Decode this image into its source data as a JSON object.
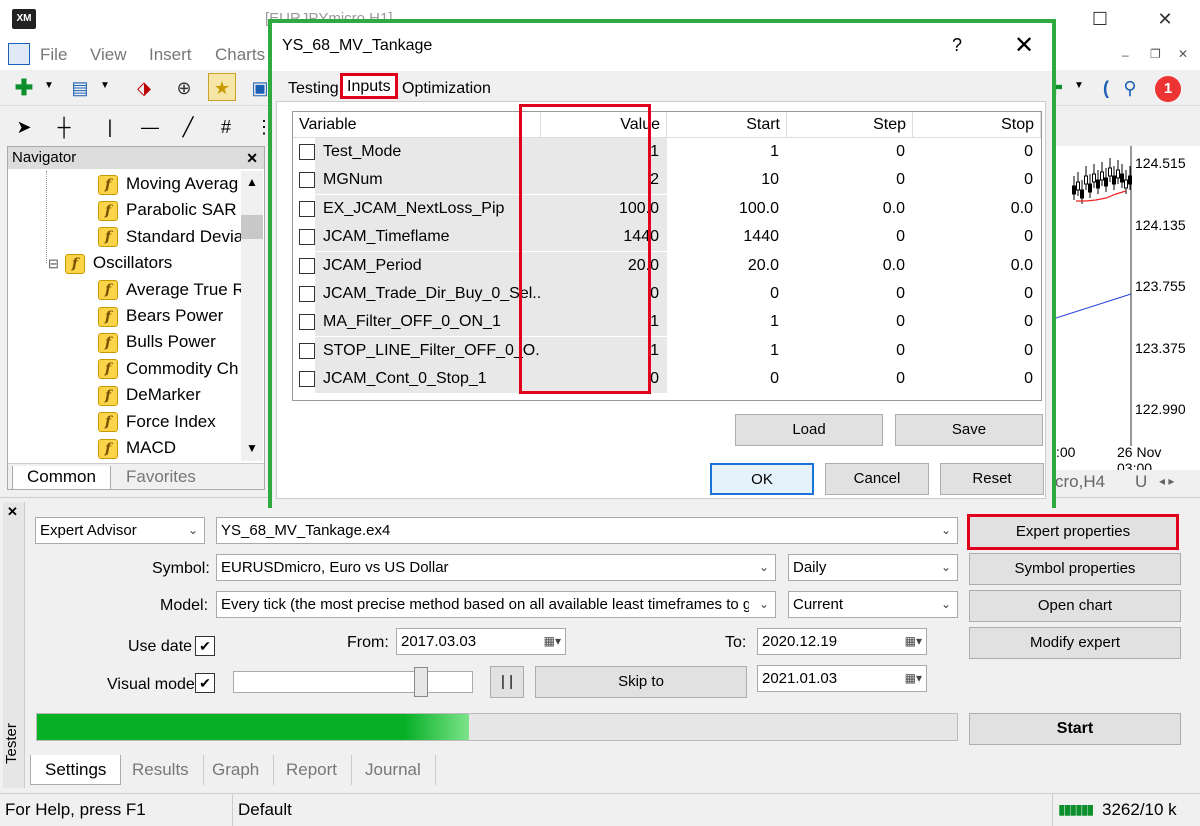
{
  "window": {
    "title": "[EURJPYmicro,H1]",
    "logo": "XM",
    "minimize": "—",
    "maximize": "☐",
    "close": "✕"
  },
  "menu": [
    "File",
    "View",
    "Insert",
    "Charts"
  ],
  "mdi_controls": {
    "minimize": "–",
    "restore": "❐",
    "close": "✕"
  },
  "notification_count": "1",
  "navigator": {
    "title": "Navigator",
    "close": "✕",
    "items": [
      {
        "label": "Moving Averag",
        "indent": 2
      },
      {
        "label": "Parabolic SAR",
        "indent": 2
      },
      {
        "label": "Standard Devia",
        "indent": 2
      },
      {
        "label": "Oscillators",
        "indent": 1
      },
      {
        "label": "Average True R",
        "indent": 2
      },
      {
        "label": "Bears Power",
        "indent": 2
      },
      {
        "label": "Bulls Power",
        "indent": 2
      },
      {
        "label": "Commodity Ch",
        "indent": 2
      },
      {
        "label": "DeMarker",
        "indent": 2
      },
      {
        "label": "Force Index",
        "indent": 2
      },
      {
        "label": "MACD",
        "indent": 2
      }
    ],
    "tabs": [
      "Common",
      "Favorites"
    ]
  },
  "chart": {
    "prices": [
      "124.515",
      "124.135",
      "123.755",
      "123.375",
      "122.990"
    ],
    "time_labels": [
      ":00",
      "26 Nov 03:00"
    ],
    "tabs": [
      "cro,H4",
      "U"
    ]
  },
  "dialog": {
    "title": "YS_68_MV_Tankage",
    "help": "?",
    "close": "✕",
    "tabs": [
      "Testing",
      "Inputs",
      "Optimization"
    ],
    "columns": [
      "Variable",
      "Value",
      "Start",
      "Step",
      "Stop"
    ],
    "rows": [
      {
        "variable": "Test_Mode",
        "value": "1",
        "start": "1",
        "step": "0",
        "stop": "0"
      },
      {
        "variable": "MGNum",
        "value": "2",
        "start": "10",
        "step": "0",
        "stop": "0"
      },
      {
        "variable": "EX_JCAM_NextLoss_Pip",
        "value": "100.0",
        "start": "100.0",
        "step": "0.0",
        "stop": "0.0"
      },
      {
        "variable": "JCAM_Timeflame",
        "value": "1440",
        "start": "1440",
        "step": "0",
        "stop": "0"
      },
      {
        "variable": "JCAM_Period",
        "value": "20.0",
        "start": "20.0",
        "step": "0.0",
        "stop": "0.0"
      },
      {
        "variable": "JCAM_Trade_Dir_Buy_0_Sel...",
        "value": "0",
        "start": "0",
        "step": "0",
        "stop": "0"
      },
      {
        "variable": "MA_Filter_OFF_0_ON_1",
        "value": "1",
        "start": "1",
        "step": "0",
        "stop": "0"
      },
      {
        "variable": "STOP_LINE_Filter_OFF_0_O...",
        "value": "1",
        "start": "1",
        "step": "0",
        "stop": "0"
      },
      {
        "variable": "JCAM_Cont_0_Stop_1",
        "value": "0",
        "start": "0",
        "step": "0",
        "stop": "0"
      }
    ],
    "load": "Load",
    "save": "Save",
    "ok": "OK",
    "cancel": "Cancel",
    "reset": "Reset"
  },
  "tester": {
    "side_label": "Tester",
    "close": "✕",
    "mode": "Expert Advisor",
    "expert": "YS_68_MV_Tankage.ex4",
    "symbol_label": "Symbol:",
    "symbol": "EURUSDmicro, Euro vs US Dollar",
    "period": "Daily",
    "model_label": "Model:",
    "model": "Every tick (the most precise method based on all available least timeframes to ge",
    "spread": "Current",
    "use_date_label": "Use date",
    "use_date_checked": true,
    "from_label": "From:",
    "from": "2017.03.03",
    "to_label": "To:",
    "to": "2020.12.19",
    "visual_label": "Visual mode",
    "visual_checked": true,
    "pause": "| |",
    "skip_to": "Skip to",
    "skip_date": "2021.01.03",
    "progress": 0.47,
    "buttons": [
      "Expert properties",
      "Symbol properties",
      "Open chart",
      "Modify expert"
    ],
    "start": "Start",
    "tabs": [
      "Settings",
      "Results",
      "Graph",
      "Report",
      "Journal"
    ]
  },
  "status": {
    "help": "For Help, press F1",
    "profile": "Default",
    "traffic": "3262/10 k"
  }
}
